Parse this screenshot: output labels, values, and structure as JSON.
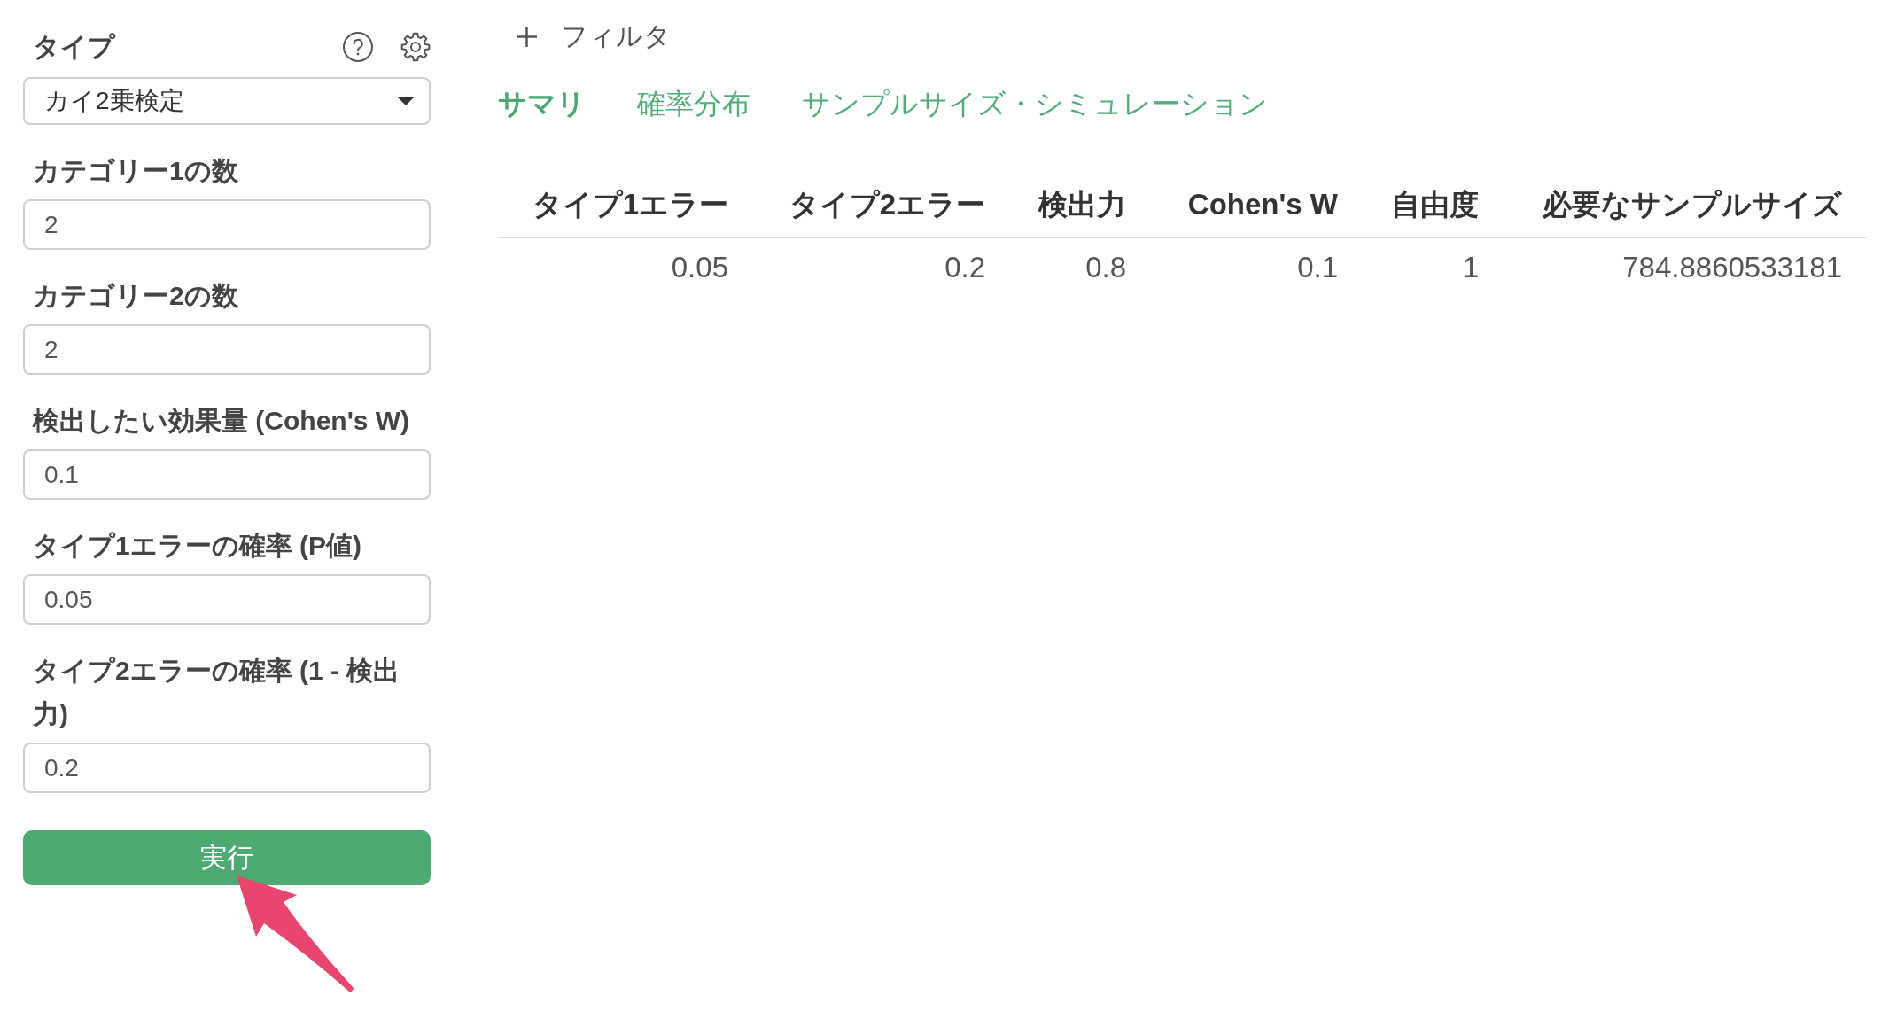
{
  "sidebar": {
    "type": {
      "label": "タイプ",
      "value": "カイ2乗検定"
    },
    "fields": [
      {
        "label": "カテゴリー1の数",
        "value": "2"
      },
      {
        "label": "カテゴリー2の数",
        "value": "2"
      },
      {
        "label": "検出したい効果量 (Cohen's W)",
        "value": "0.1"
      },
      {
        "label": "タイプ1エラーの確率 (P値)",
        "value": "0.05"
      },
      {
        "label": "タイプ2エラーの確率 (1 - 検出力)",
        "value": "0.2"
      }
    ],
    "run_button": "実行"
  },
  "filter_button": "フィルタ",
  "tabs": [
    {
      "label": "サマリ",
      "selected": true
    },
    {
      "label": "確率分布",
      "selected": false
    },
    {
      "label": "サンプルサイズ・シミュレーション",
      "selected": false
    }
  ],
  "table": {
    "columns": [
      "タイプ1エラー",
      "タイプ2エラー",
      "検出力",
      "Cohen's W",
      "自由度",
      "必要なサンプルサイズ"
    ],
    "rows": [
      [
        "0.05",
        "0.2",
        "0.8",
        "0.1",
        "1",
        "784.8860533181"
      ]
    ]
  }
}
